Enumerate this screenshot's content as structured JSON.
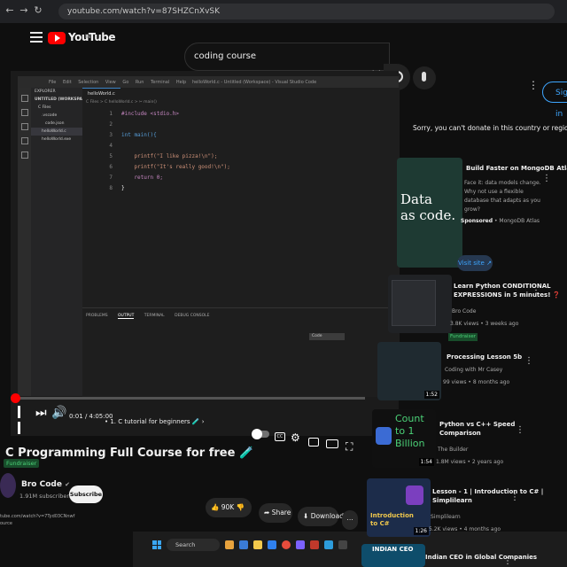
{
  "browser": {
    "url": "youtube.com/watch?v=87SHZCnXvSK"
  },
  "header": {
    "logo_text": "YouTube",
    "country_code": "IN",
    "search_value": "coding course",
    "sign_in_label": "Sign in"
  },
  "vscode": {
    "menu": [
      "File",
      "Edit",
      "Selection",
      "View",
      "Go",
      "Run",
      "Terminal",
      "Help"
    ],
    "window_title": "helloWorld.c - Untitled (Workspace) - Visual Studio Code",
    "explorer_title": "EXPLORER",
    "explorer_items": [
      "UNTITLED (WORKSPACE)",
      "C Files",
      ".vscode",
      "code.json",
      "helloWorld.c",
      "helloWorld.exe"
    ],
    "tab_label": "helloWorld.c",
    "breadcrumb": "C Files > C helloWorld.c > ✂ main()",
    "code": [
      {
        "ln": "1",
        "text": "#include <stdio.h>"
      },
      {
        "ln": "2",
        "text": ""
      },
      {
        "ln": "3",
        "text": "int main(){"
      },
      {
        "ln": "4",
        "text": ""
      },
      {
        "ln": "5",
        "text": "    printf(\"I like pizza!\\n\");"
      },
      {
        "ln": "6",
        "text": "    printf(\"It's really good!\\n\");"
      },
      {
        "ln": "7",
        "text": "    return 0;"
      },
      {
        "ln": "8",
        "text": "}"
      }
    ],
    "panel_tabs": [
      "PROBLEMS",
      "OUTPUT",
      "TERMINAL",
      "DEBUG CONSOLE"
    ],
    "panel_select": "Code"
  },
  "player": {
    "time": "0:01 / 4:05:00",
    "chapter": "• 1. C tutorial for beginners 🧪 ›",
    "progress_fraction": 0.0
  },
  "video": {
    "title": "C Programming Full Course for free 🧪",
    "fundraiser_label": "Fundraiser",
    "channel": "Bro Code",
    "subscribers": "1.91M subscribers",
    "subscribe_label": "Subscribe",
    "likes": "90K",
    "share_label": "Share",
    "download_label": "Download"
  },
  "status_bar": {
    "url": "tube.com/watch?v=7Tyd03CNnwf",
    "source": "ource"
  },
  "taskbar": {
    "search_label": "Search"
  },
  "sidebar": {
    "donate_message": "Sorry, you can't donate in this country or region yet.",
    "ad": {
      "thumb_text_line1": "Data",
      "thumb_text_line2": "as code.",
      "title": "Build Faster on MongoDB Atlas",
      "description": "Face it: data models change. Why not use a flexible database that adapts as you grow?",
      "sponsored_label": "Sponsored",
      "advertiser": "• MongoDB Atlas",
      "visit_label": "Visit site"
    },
    "videos": [
      {
        "title_line1": "Learn Python CONDITIONAL",
        "title_line2": "EXPRESSIONS in 5 minutes! ❓",
        "channel": "Bro Code",
        "meta": "3.8K views • 3 weeks ago",
        "badge": "Fundraiser",
        "duration": ""
      },
      {
        "title_line1": "Processing Lesson 5b",
        "title_line2": "",
        "channel": "Coding with Mr Casey",
        "meta": "99 views • 8 months ago",
        "badge": "",
        "duration": "1:52"
      },
      {
        "title_line1": "Python vs C++ Speed",
        "title_line2": "Comparison",
        "channel": "The Builder",
        "meta": "1.8M views • 2 years ago",
        "badge": "",
        "duration": "1:54",
        "thumb_text": "Count to 1 Billion"
      },
      {
        "title_line1": "Lesson - 1 | Introduction to C# |",
        "title_line2": "Simplilearn",
        "channel": "Simplilearn",
        "meta": "5.2K views • 4 months ago",
        "badge": "",
        "duration": "1:26",
        "thumb_text": "Introduction to C#"
      },
      {
        "title_line1": "Indian CEO in Global Companies",
        "title_line2": "",
        "channel": "",
        "meta": "",
        "badge": "",
        "duration": "",
        "thumb_text": "INDIAN CEO"
      }
    ]
  },
  "colors": {
    "accent_red": "#ff0000",
    "link_blue": "#3ea6ff",
    "fundraiser_green": "#4bd177"
  }
}
